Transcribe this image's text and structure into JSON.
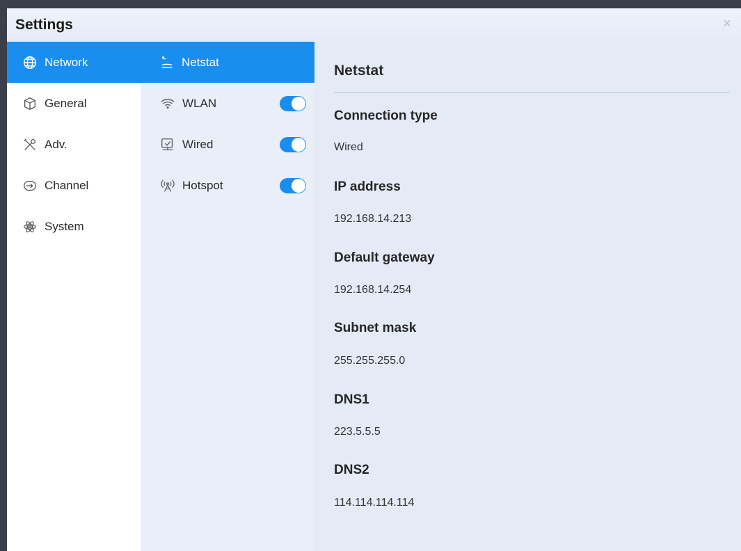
{
  "window": {
    "title": "Settings",
    "close_glyph": "×"
  },
  "primary_nav": [
    {
      "label": "Network",
      "icon": "globe-icon",
      "active": true
    },
    {
      "label": "General",
      "icon": "cube-icon",
      "active": false
    },
    {
      "label": "Adv.",
      "icon": "tools-icon",
      "active": false
    },
    {
      "label": "Channel",
      "icon": "channel-icon",
      "active": false
    },
    {
      "label": "System",
      "icon": "atom-icon",
      "active": false
    }
  ],
  "secondary_nav": [
    {
      "label": "Netstat",
      "icon": "netstat-icon",
      "active": true,
      "toggle": null
    },
    {
      "label": "WLAN",
      "icon": "wifi-icon",
      "active": false,
      "toggle": true
    },
    {
      "label": "Wired",
      "icon": "monitor-icon",
      "active": false,
      "toggle": true
    },
    {
      "label": "Hotspot",
      "icon": "hotspot-icon",
      "active": false,
      "toggle": true
    }
  ],
  "panel": {
    "title": "Netstat",
    "fields": [
      {
        "label": "Connection type",
        "value": "Wired"
      },
      {
        "label": "IP address",
        "value": "192.168.14.213"
      },
      {
        "label": "Default gateway",
        "value": "192.168.14.254"
      },
      {
        "label": "Subnet mask",
        "value": "255.255.255.0"
      },
      {
        "label": "DNS1",
        "value": "223.5.5.5"
      },
      {
        "label": "DNS2",
        "value": "114.114.114.114"
      }
    ]
  },
  "colors": {
    "accent": "#1a8ef0",
    "background": "#e4ebf6"
  }
}
